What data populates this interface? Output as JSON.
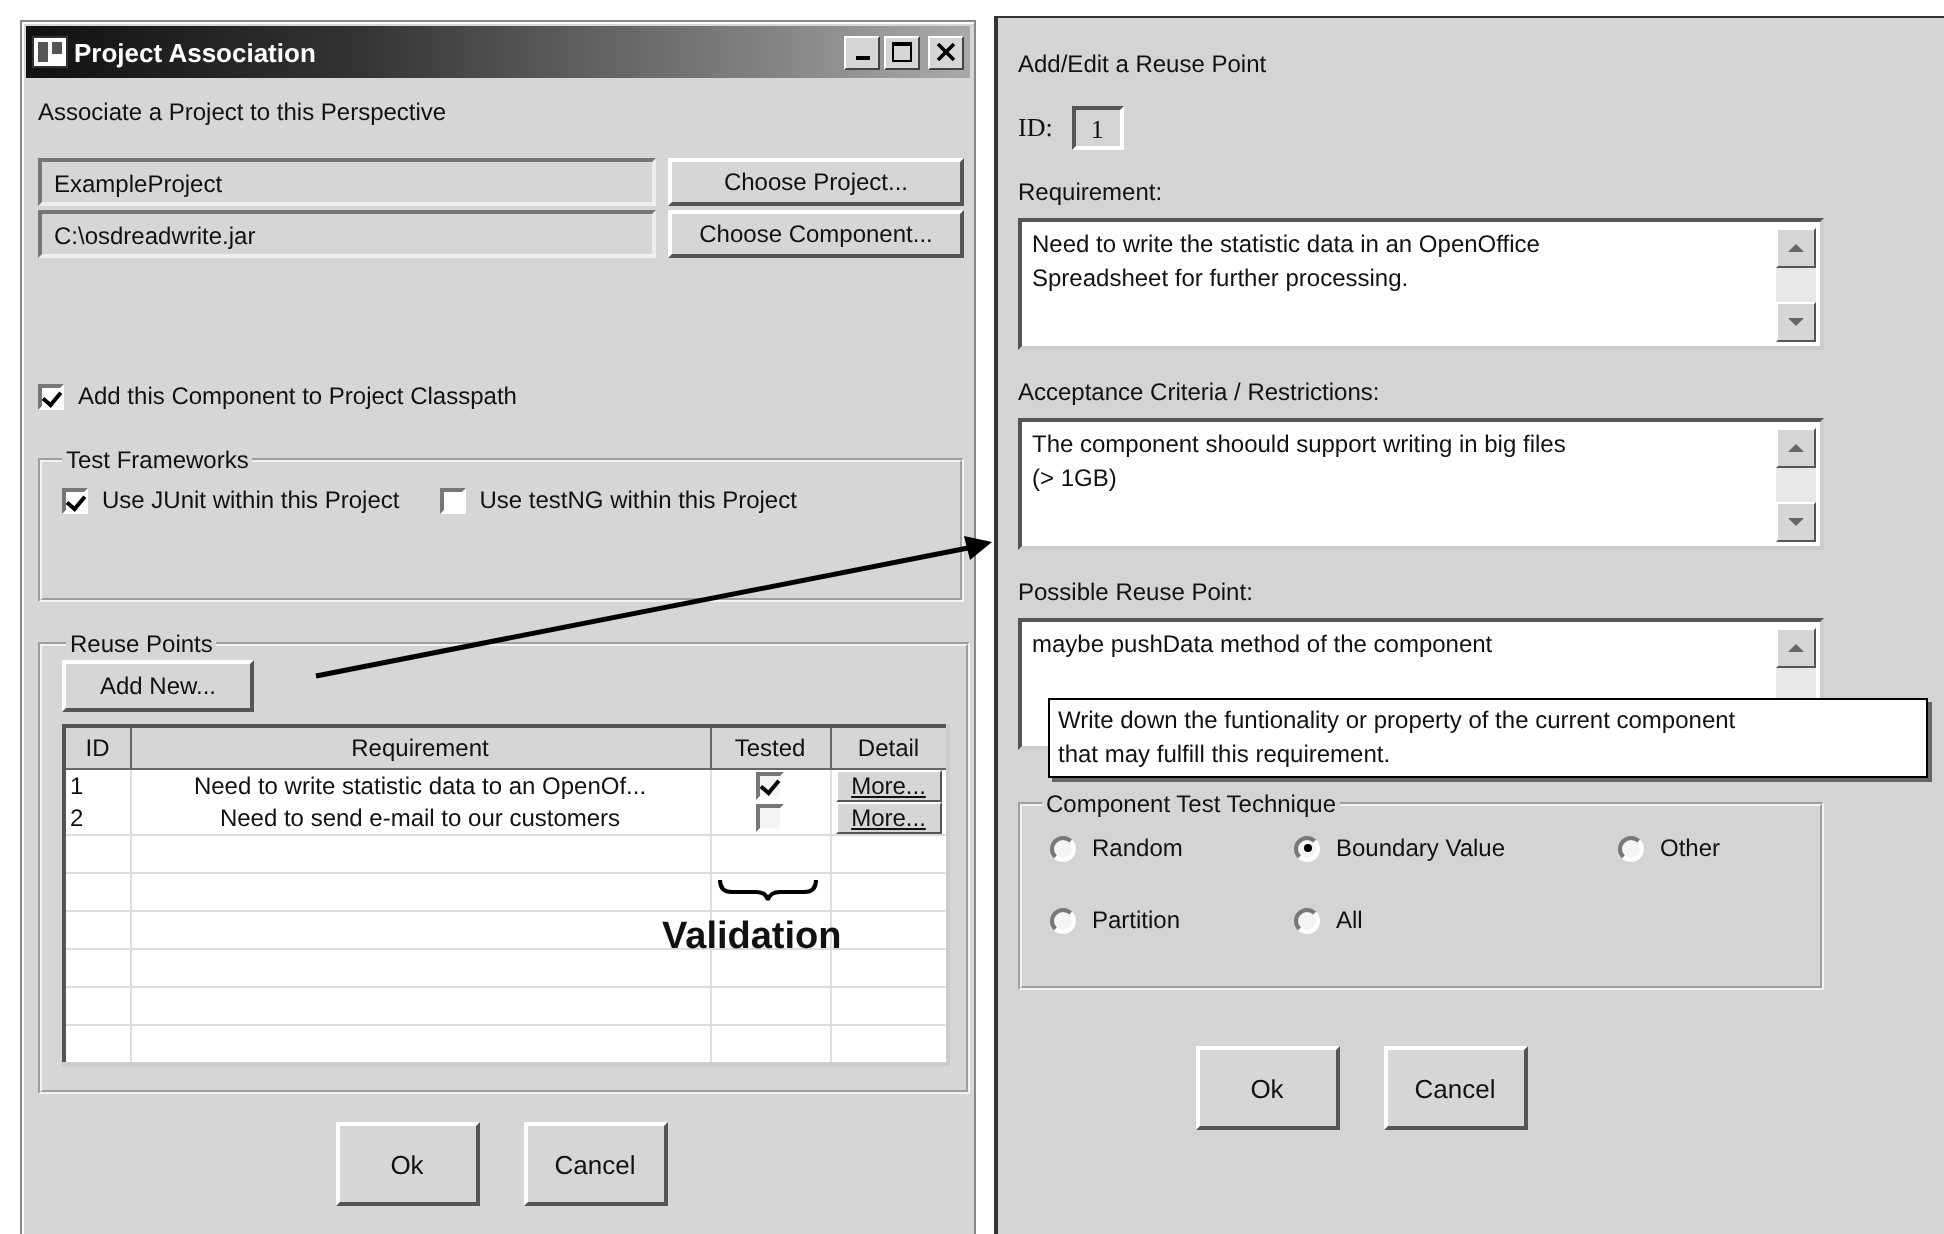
{
  "project_window": {
    "title": "Project Association",
    "subtitle": "Associate a Project to this Perspective",
    "fields": [
      {
        "value": "ExampleProject",
        "button": "Choose Project..."
      },
      {
        "value": "C:\\osdreadwrite.jar",
        "button": "Choose Component..."
      }
    ],
    "classpath_checkbox": {
      "label": "Add this Component to Project Classpath",
      "checked": true
    },
    "test_frameworks": {
      "title": "Test Frameworks",
      "options": [
        {
          "label": "Use JUnit within this Project",
          "checked": true
        },
        {
          "label": "Use testNG within this Project",
          "checked": false
        }
      ]
    },
    "reuse_points": {
      "title": "Reuse Points",
      "add_button": "Add New...",
      "table": {
        "columns": [
          "ID",
          "Requirement",
          "Tested",
          "Detail"
        ],
        "rows": [
          {
            "id": "1",
            "requirement": "Need to write statistic data to an OpenOf...",
            "tested": true,
            "detail": "More..."
          },
          {
            "id": "2",
            "requirement": "Need to send e-mail to our customers",
            "tested": false,
            "detail": "More..."
          }
        ]
      }
    },
    "buttons": [
      "Ok",
      "Cancel"
    ]
  },
  "annotation": {
    "label": "Validation"
  },
  "reuse_point_dialog": {
    "title": "Add/Edit a Reuse Point",
    "id_label": "ID:",
    "id_value": "1",
    "text_areas": [
      {
        "label": "Requirement:",
        "value": "Need to write the statistic data in an OpenOffice\nSpreadsheet for further processing."
      },
      {
        "label": "Acceptance Criteria / Restrictions:",
        "value": "The component shoould support writing in big files\n(> 1GB)"
      },
      {
        "label": "Possible Reuse Point:",
        "value": "maybe pushData method of the component"
      }
    ],
    "tooltip": "Write down the funtionality or property of the current component\n that may fulfill this requirement.",
    "technique": {
      "title": "Component Test Technique",
      "options": [
        {
          "label": "Random",
          "selected": false
        },
        {
          "label": "Boundary Value",
          "selected": true
        },
        {
          "label": "Other",
          "selected": false
        },
        {
          "label": "Partition",
          "selected": false
        },
        {
          "label": "All",
          "selected": false
        }
      ]
    },
    "buttons": [
      "Ok",
      "Cancel"
    ]
  }
}
